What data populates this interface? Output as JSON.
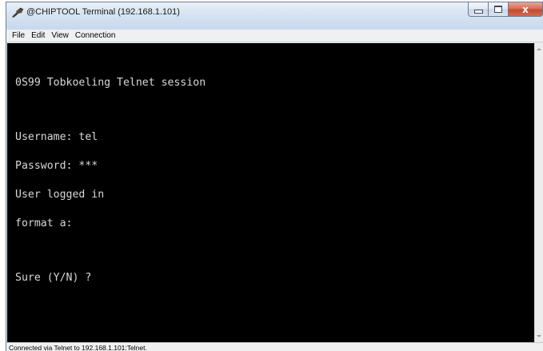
{
  "window": {
    "title": "@CHIPTOOL Terminal (192.168.1.101)",
    "app_icon": "chiptool-icon",
    "caption_icons": [
      "minimize-icon",
      "maximize-icon",
      "close-icon"
    ],
    "close_glyph": "x"
  },
  "menubar": {
    "items": [
      "File",
      "Edit",
      "View",
      "Connection"
    ]
  },
  "terminal": {
    "background": "#000000",
    "foreground": "#d8d8d8",
    "lines": [
      "0S99 Tobkoeling Telnet session",
      "",
      "Username: tel",
      "Password: ***",
      "User logged in",
      "format a:",
      "",
      "Sure (Y/N) ?"
    ]
  },
  "statusbar": {
    "text": "Connected via Telnet to 192.168.1.101:Telnet."
  }
}
